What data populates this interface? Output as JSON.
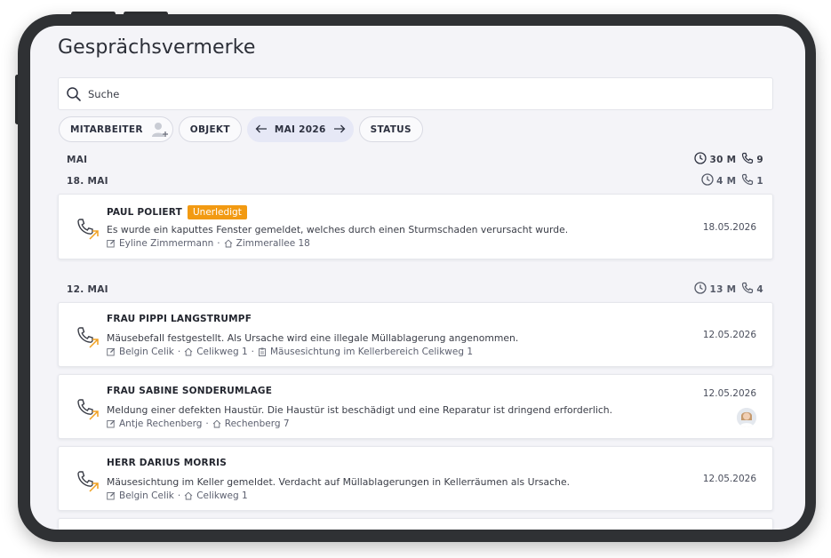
{
  "page": {
    "title": "Gesprächsvermerke"
  },
  "search": {
    "placeholder": "Suche"
  },
  "filters": {
    "mitarbeiter": "MITARBEITER",
    "objekt": "OBJEKT",
    "month": "MAI 2026",
    "status": "STATUS"
  },
  "month_group": {
    "label": "MAI",
    "duration": "30 M",
    "calls": "9"
  },
  "days": [
    {
      "label": "18. MAI",
      "duration": "4 M",
      "calls": "1"
    },
    {
      "label": "12. MAI",
      "duration": "13 M",
      "calls": "4"
    }
  ],
  "entries": [
    {
      "name": "PAUL POLIERT",
      "badge": "Unerledigt",
      "text": "Es wurde ein kaputtes Fenster gemeldet, welches durch einen Sturmschaden verursacht wurde.",
      "author": "Eyline Zimmermann",
      "property": "Zimmerallee 18",
      "date": "18.05.2026"
    },
    {
      "name": "FRAU PIPPI LANGSTRUMPF",
      "text": "Mäusebefall festgestellt. Als Ursache wird eine illegale Müllablagerung angenommen.",
      "author": "Belgin Celik",
      "property": "Celikweg 1",
      "task": "Mäusesichtung im Kellerbereich Celikweg 1",
      "date": "12.05.2026"
    },
    {
      "name": "FRAU SABINE SONDERUMLAGE",
      "text": "Meldung einer defekten Haustür. Die Haustür ist beschädigt und eine Reparatur ist dringend erforderlich.",
      "author": "Antje Rechenberg",
      "property": "Rechenberg 7",
      "date": "12.05.2026"
    },
    {
      "name": "HERR DARIUS MORRIS",
      "text": "Mäusesichtung im Keller gemeldet. Verdacht auf Müllablagerungen in Kellerräumen als Ursache.",
      "author": "Belgin Celik",
      "property": "Celikweg 1",
      "date": "12.05.2026"
    }
  ],
  "meta_separator": "·",
  "colors": {
    "badge": "#f29a12",
    "arrow_accent": "#f0a020",
    "month_chip": "#e6e8f6"
  }
}
